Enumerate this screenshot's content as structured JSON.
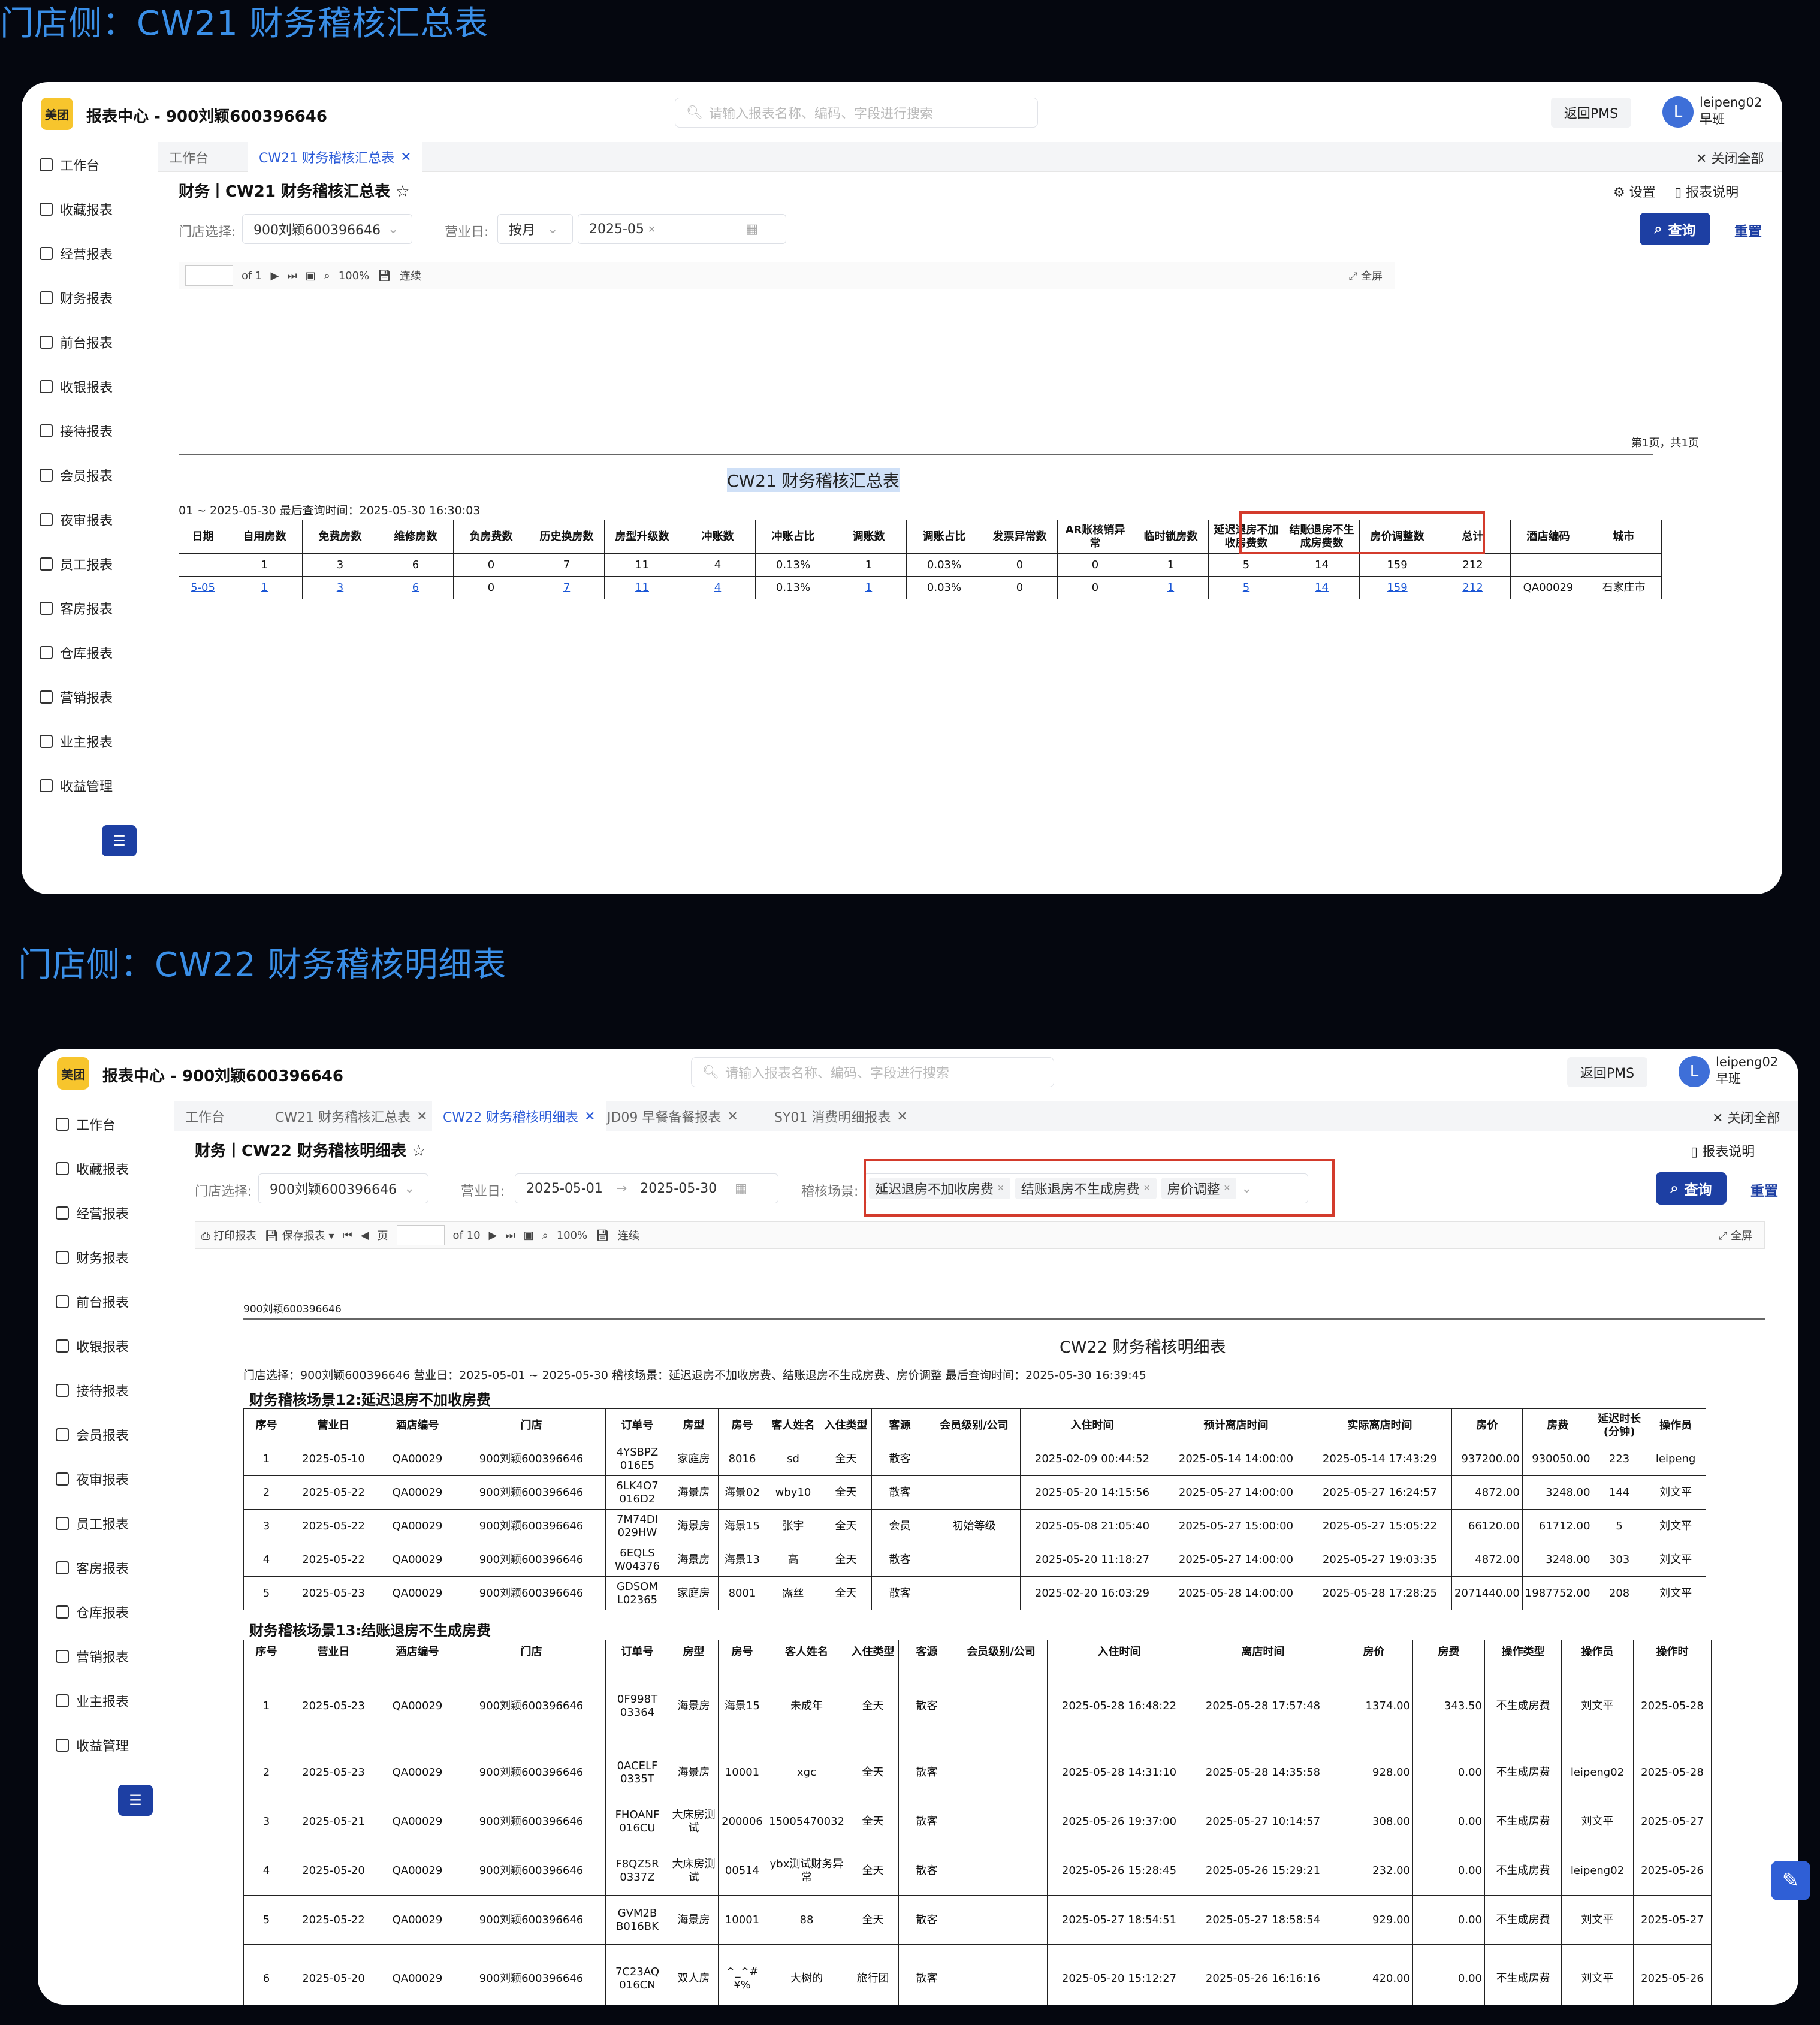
{
  "headings": {
    "top": "门店侧：CW21 财务稽核汇总表",
    "bottom": "门店侧：CW22 财务稽核明细表"
  },
  "common": {
    "logo": "美团",
    "app_title": "报表中心 - 900刘颖600396646",
    "search_placeholder": "请输入报表名称、编码、字段进行搜索",
    "return_pms": "返回PMS",
    "avatar_letter": "L",
    "user_name": "leipeng02",
    "user_shift": "早班",
    "close_all": "关闭全部",
    "query": "查询",
    "reset": "重置",
    "store_label": "门店选择:",
    "store_value": "900刘颖600396646",
    "bizday_label": "营业日:",
    "report_desc": "报表说明",
    "settings": "设置",
    "zoom": "100%",
    "continuous": "连续",
    "fullscreen": "全屏",
    "sidebar": [
      "工作台",
      "收藏报表",
      "经营报表",
      "财务报表",
      "前台报表",
      "收银报表",
      "接待报表",
      "会员报表",
      "夜审报表",
      "员工报表",
      "客房报表",
      "仓库报表",
      "营销报表",
      "业主报表",
      "收益管理"
    ]
  },
  "cw21": {
    "tabs": [
      "工作台",
      "CW21 财务稽核汇总表"
    ],
    "title": "财务丨CW21 财务稽核汇总表",
    "period_mode": "按月",
    "month": "2025-05",
    "of_pages": "of 1",
    "page_info": "第1页，共1页",
    "doc_title": "CW21 财务稽核汇总表",
    "meta": "01 ~ 2025-05-30      最后查询时间：2025-05-30 16:30:03",
    "headers": [
      "日期",
      "自用房数",
      "免费房数",
      "维修房数",
      "负房费数",
      "历史换房数",
      "房型升级数",
      "冲账数",
      "冲账占比",
      "调账数",
      "调账占比",
      "发票异常数",
      "AR账核销异常",
      "临时锁房数",
      "延迟退房不加收房费数",
      "结账退房不生成房费数",
      "房价调整数",
      "总计",
      "酒店编码",
      "城市"
    ],
    "total_row": [
      "",
      "1",
      "3",
      "6",
      "0",
      "7",
      "11",
      "4",
      "0.13%",
      "1",
      "0.03%",
      "0",
      "0",
      "1",
      "5",
      "14",
      "159",
      "212",
      "",
      ""
    ],
    "data_row": [
      "5-05",
      "1",
      "3",
      "6",
      "0",
      "7",
      "11",
      "4",
      "0.13%",
      "1",
      "0.03%",
      "0",
      "0",
      "1",
      "5",
      "14",
      "159",
      "212",
      "QA00029",
      "石家庄市"
    ]
  },
  "cw22": {
    "tabs": [
      "工作台",
      "CW21 财务稽核汇总表",
      "CW22 财务稽核明细表",
      "JD09 早餐备餐报表",
      "SY01 消费明细报表"
    ],
    "title": "财务丨CW22 财务稽核明细表",
    "date_from": "2025-05-01",
    "date_to": "2025-05-30",
    "scene_label": "稽核场景:",
    "scene_chips": [
      "延迟退房不加收房费",
      "结账退房不生成房费",
      "房价调整"
    ],
    "print": "打印报表",
    "save": "保存报表",
    "page_word": "页",
    "of_pages": "of 10",
    "store_line": "900刘颖600396646",
    "doc_title": "CW22 财务稽核明细表",
    "meta": "门店选择：900刘颖600396646    营业日：2025-05-01 ~ 2025-05-30    稽核场景：延迟退房不加收房费、结账退房不生成房费、房价调整    最后查询时间：2025-05-30 16:39:45",
    "section1": "财务稽核场景12:延迟退房不加收房费",
    "headers1": [
      "序号",
      "营业日",
      "酒店编号",
      "门店",
      "订单号",
      "房型",
      "房号",
      "客人姓名",
      "入住类型",
      "客源",
      "会员级别/公司",
      "入住时间",
      "预计离店时间",
      "实际离店时间",
      "房价",
      "房费",
      "延迟时长(分钟)",
      "操作员"
    ],
    "rows1": [
      [
        "1",
        "2025-05-10",
        "QA00029",
        "900刘颖600396646",
        "4YSBPZ 016E5",
        "家庭房",
        "8016",
        "sd",
        "全天",
        "散客",
        "",
        "2025-02-09 00:44:52",
        "2025-05-14 14:00:00",
        "2025-05-14 17:43:29",
        "937200.00",
        "930050.00",
        "223",
        "leipeng"
      ],
      [
        "2",
        "2025-05-22",
        "QA00029",
        "900刘颖600396646",
        "6LK4O7 016D2",
        "海景房",
        "海景02",
        "wby10",
        "全天",
        "散客",
        "",
        "2025-05-20 14:15:56",
        "2025-05-27 14:00:00",
        "2025-05-27 16:24:57",
        "4872.00",
        "3248.00",
        "144",
        "刘文平"
      ],
      [
        "3",
        "2025-05-22",
        "QA00029",
        "900刘颖600396646",
        "7M74DI 029HW",
        "海景房",
        "海景15",
        "张宇",
        "全天",
        "会员",
        "初始等级",
        "2025-05-08 21:05:40",
        "2025-05-27 15:00:00",
        "2025-05-27 15:05:22",
        "66120.00",
        "61712.00",
        "5",
        "刘文平"
      ],
      [
        "4",
        "2025-05-22",
        "QA00029",
        "900刘颖600396646",
        "6EQLS W04376",
        "海景房",
        "海景13",
        "高",
        "全天",
        "散客",
        "",
        "2025-05-20 11:18:27",
        "2025-05-27 14:00:00",
        "2025-05-27 19:03:35",
        "4872.00",
        "3248.00",
        "303",
        "刘文平"
      ],
      [
        "5",
        "2025-05-23",
        "QA00029",
        "900刘颖600396646",
        "GDSOM L02365",
        "家庭房",
        "8001",
        "露丝",
        "全天",
        "散客",
        "",
        "2025-02-20 16:03:29",
        "2025-05-28 14:00:00",
        "2025-05-28 17:28:25",
        "2071440.00",
        "1987752.00",
        "208",
        "刘文平"
      ]
    ],
    "section2": "财务稽核场景13:结账退房不生成房费",
    "headers2": [
      "序号",
      "营业日",
      "酒店编号",
      "门店",
      "订单号",
      "房型",
      "房号",
      "客人姓名",
      "入住类型",
      "客源",
      "会员级别/公司",
      "入住时间",
      "离店时间",
      "房价",
      "房费",
      "操作类型",
      "操作员",
      "操作时"
    ],
    "rows2": [
      [
        "1",
        "2025-05-23",
        "QA00029",
        "900刘颖600396646",
        "0F998T 03364",
        "海景房",
        "海景15",
        "未成年",
        "全天",
        "散客",
        "",
        "2025-05-28 16:48:22",
        "2025-05-28 17:57:48",
        "1374.00",
        "343.50",
        "不生成房费",
        "刘文平",
        "2025-05-28"
      ],
      [
        "2",
        "2025-05-23",
        "QA00029",
        "900刘颖600396646",
        "0ACELF 0335T",
        "海景房",
        "10001",
        "xgc",
        "全天",
        "散客",
        "",
        "2025-05-28 14:31:10",
        "2025-05-28 14:35:58",
        "928.00",
        "0.00",
        "不生成房费",
        "leipeng02",
        "2025-05-28"
      ],
      [
        "3",
        "2025-05-21",
        "QA00029",
        "900刘颖600396646",
        "FHOANF 016CU",
        "大床房测试",
        "200006",
        "15005470032",
        "全天",
        "散客",
        "",
        "2025-05-26 19:37:00",
        "2025-05-27 10:14:57",
        "308.00",
        "0.00",
        "不生成房费",
        "刘文平",
        "2025-05-27"
      ],
      [
        "4",
        "2025-05-20",
        "QA00029",
        "900刘颖600396646",
        "F8QZ5R 0337Z",
        "大床房测试",
        "00514",
        "ybx测试财务异常",
        "全天",
        "散客",
        "",
        "2025-05-26 15:28:45",
        "2025-05-26 15:29:21",
        "232.00",
        "0.00",
        "不生成房费",
        "leipeng02",
        "2025-05-26"
      ],
      [
        "5",
        "2025-05-22",
        "QA00029",
        "900刘颖600396646",
        "GVM2B B016BK",
        "海景房",
        "10001",
        "88",
        "全天",
        "散客",
        "",
        "2025-05-27 18:54:51",
        "2025-05-27 18:58:54",
        "929.00",
        "0.00",
        "不生成房费",
        "刘文平",
        "2025-05-27"
      ],
      [
        "6",
        "2025-05-20",
        "QA00029",
        "900刘颖600396646",
        "7C23AQ 016CN",
        "双人房",
        "^_^# ¥%",
        "大树的",
        "旅行团",
        "散客",
        "",
        "2025-05-20 15:12:27",
        "2025-05-26 16:16:16",
        "420.00",
        "0.00",
        "不生成房费",
        "刘文平",
        "2025-05-26"
      ]
    ]
  }
}
